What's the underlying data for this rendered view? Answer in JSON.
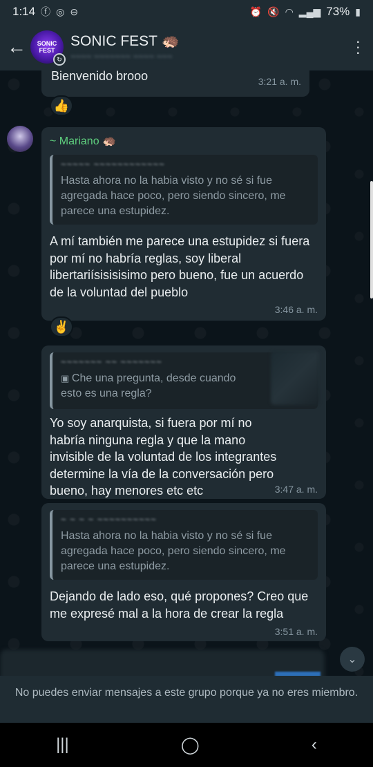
{
  "status_bar": {
    "time": "1:14",
    "left_icons": [
      "facebook-icon",
      "instagram-icon",
      "minus-circle-icon"
    ],
    "battery": "73%"
  },
  "header": {
    "title": "SONIC FEST 🦔",
    "avatar_text": "SONIC FEST",
    "subtitle": "~~~~ ~~~~~~~ ~~~~ ~~~"
  },
  "messages": [
    {
      "text": "Bienvenido brooo",
      "time": "3:21 a. m.",
      "reaction": "👍"
    },
    {
      "sender": "~ Mariano 🦔",
      "quote_author": "~~~~~ ~~~~~~~~~~~~",
      "quote_text": "Hasta ahora no la habia visto y no sé si fue agregada hace poco, pero siendo sincero, me parece una estupidez.",
      "text": "A mí también me parece una estupidez si fuera por mí no habría reglas, soy liberal libertariísisisisimo pero bueno, fue un acuerdo de la voluntad del pueblo",
      "time": "3:46 a. m.",
      "reaction": "✌️"
    },
    {
      "quote_author": "~~~~~~~ ~~ ~~~~~~~",
      "quote_text": "Che una pregunta, desde cuando esto es una regla?",
      "text": "Yo soy anarquista, si fuera por mí no habría ninguna regla y que la mano invisible de la voluntad de los integrantes determine la vía de la conversación pero bueno, hay menores etc etc",
      "time": "3:47 a. m."
    },
    {
      "quote_author": "~ ~ ~ ~ ~~~~~~~~~~",
      "quote_text": "Hasta ahora no la habia visto y no sé si fue agregada hace poco, pero siendo sincero, me parece una estupidez.",
      "text": "Dejando de lado eso, qué propones? Creo que me expresé mal a la hora de crear la regla",
      "time": "3:51 a. m."
    }
  ],
  "footer": {
    "notice": "No puedes enviar mensajes a este grupo porque ya no eres miembro."
  },
  "colors": {
    "chat_bg": "#0b141a",
    "bubble_bg": "#202c33",
    "header_bg": "#1f2c33",
    "sender_name": "#5fcf7e"
  }
}
